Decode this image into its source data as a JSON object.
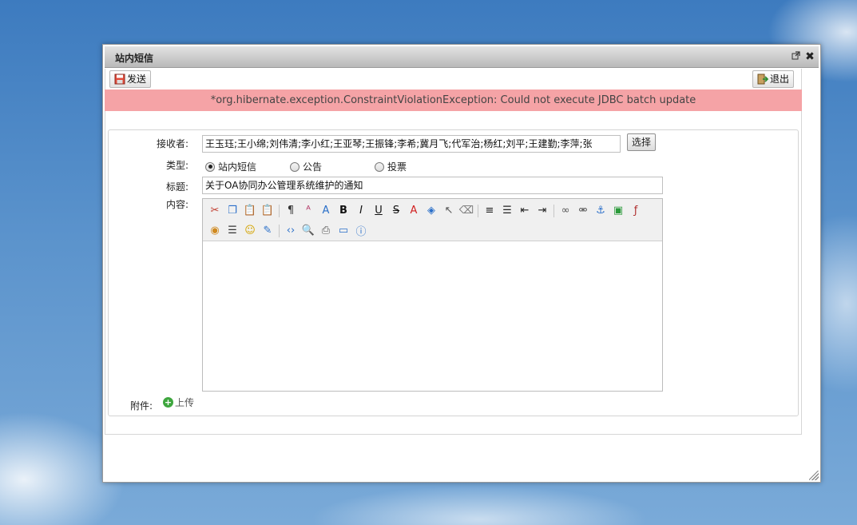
{
  "window": {
    "title": "站内短信",
    "restore_icon": "popout-icon",
    "close_icon": "close-icon"
  },
  "toolbar": {
    "send_label": "发送",
    "exit_label": "退出"
  },
  "error": {
    "message": "*org.hibernate.exception.ConstraintViolationException: Could not execute JDBC batch update"
  },
  "form": {
    "recipients_label": "接收者:",
    "recipients_value": "王玉珏;王小绵;刘伟清;李小红;王亚琴;王振锋;李希;冀月飞;代军治;杨红;刘平;王建勤;李萍;张",
    "select_button": "选择",
    "type_label": "类型:",
    "type_options": [
      {
        "label": "站内短信",
        "selected": true
      },
      {
        "label": "公告",
        "selected": false
      },
      {
        "label": "投票",
        "selected": false
      }
    ],
    "subject_label": "标题:",
    "subject_value": "关于OA协同办公管理系统维护的通知",
    "content_label": "内容:",
    "attachment_label": "附件:",
    "upload_label": "上传"
  },
  "editor_toolbar": {
    "row1": [
      "cut-icon",
      "copy-icon",
      "paste-icon",
      "paste-text-icon",
      "sep",
      "format-block-icon",
      "font-name-icon",
      "font-size-icon",
      "bold-icon",
      "italic-icon",
      "underline-icon",
      "strikethrough-icon",
      "font-color-icon",
      "highlight-color-icon",
      "select-all-icon",
      "remove-format-icon",
      "sep",
      "align-icon",
      "list-icon",
      "outdent-icon",
      "indent-icon",
      "sep",
      "link-icon",
      "unlink-icon",
      "anchor-icon",
      "image-icon",
      "flash-icon"
    ],
    "row2": [
      "media-icon",
      "horizontal-rule-icon",
      "emoticon-icon",
      "table-icon",
      "sep",
      "source-icon",
      "preview-icon",
      "print-icon",
      "fullscreen-icon",
      "about-icon"
    ]
  }
}
